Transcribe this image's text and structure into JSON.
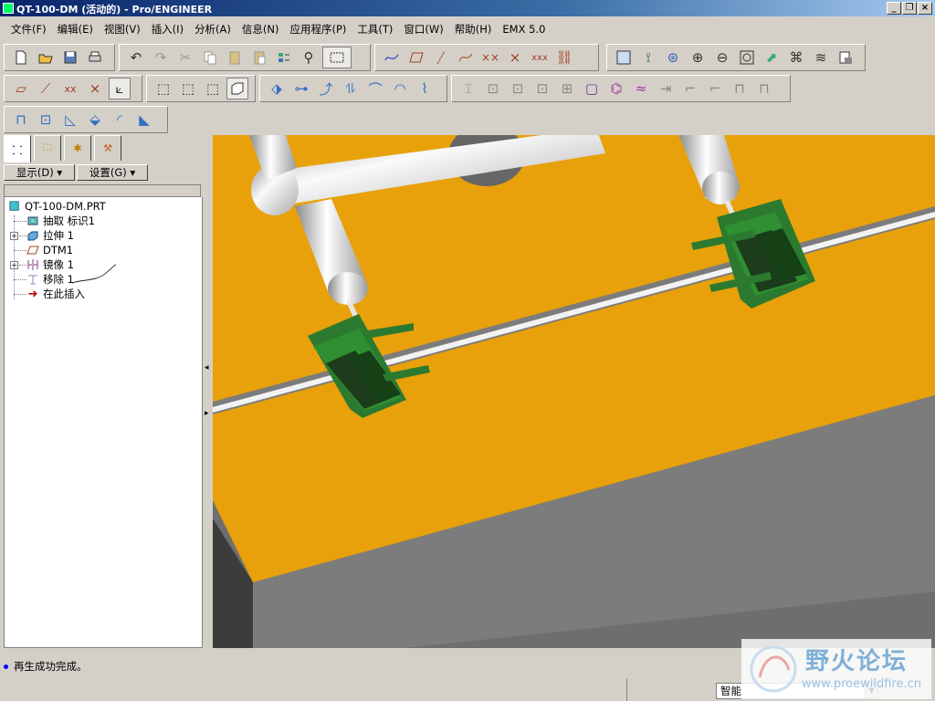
{
  "window": {
    "title": "QT-100-DM (活动的) - Pro/ENGINEER"
  },
  "menu": {
    "items": [
      "文件(F)",
      "编辑(E)",
      "视图(V)",
      "插入(I)",
      "分析(A)",
      "信息(N)",
      "应用程序(P)",
      "工具(T)",
      "窗口(W)",
      "帮助(H)",
      "EMX 5.0"
    ]
  },
  "toolbar": {
    "row1": [
      "new-icon",
      "open-icon",
      "save-icon",
      "print-icon",
      "undo-icon",
      "redo-icon",
      "cut-icon",
      "copy-icon",
      "paste-icon",
      "paste-special-icon",
      "regenerate-icon",
      "find-icon",
      "select-box-icon",
      "datum-display-icon",
      "datum-plane-icon",
      "datum-axis-icon",
      "datum-curve-icon",
      "datum-point-icon",
      "csys-icon",
      "annotation-icon",
      "repaint-icon",
      "orient-icon",
      "spin-center-icon",
      "zoom-in-icon",
      "zoom-out-icon",
      "refit-icon",
      "reorient-icon",
      "saved-views-icon",
      "layers-icon",
      "view-manager-icon"
    ],
    "row2": [
      "sketch-plane-icon",
      "axis-sketch-icon",
      "point-sketch-icon",
      "coordinate-sketch-icon",
      "analysis-icon",
      "wireframe-icon",
      "hidden-line-icon",
      "no-hidden-icon",
      "shaded-icon",
      "extrude-icon",
      "revolve-icon",
      "variable-sweep-icon",
      "blend-icon",
      "style-icon",
      "boundary-icon",
      "warp-icon",
      "hole-icon",
      "shell-icon",
      "rib-icon",
      "draft-icon",
      "round-icon",
      "chamfer-icon",
      "pattern-icon",
      "mirror-icon",
      "merge-icon",
      "trim-icon",
      "offset-icon",
      "thicken-icon",
      "solidify-icon",
      "intersect-icon",
      "project-icon"
    ],
    "row3": [
      "mirror-tool-icon",
      "merge-tool-icon",
      "trim-tool-icon",
      "extend-tool-icon",
      "offset-tool-icon",
      "intersect-tool-icon"
    ]
  },
  "panel": {
    "tabs": [
      "model-tree-icon",
      "folder-browser-icon",
      "favorites-icon",
      "connections-icon"
    ],
    "show_label": "显示(D)",
    "settings_label": "设置(G)",
    "tree": [
      {
        "label": "QT-100-DM.PRT",
        "icon": "part-icon"
      },
      {
        "label": "抽取 标识1",
        "icon": "extract-icon"
      },
      {
        "label": "拉伸 1",
        "icon": "extrude-feature-icon"
      },
      {
        "label": "DTM1",
        "icon": "datum-plane-feature-icon"
      },
      {
        "label": "镜像 1",
        "icon": "mirror-feature-icon"
      },
      {
        "label": "移除 1",
        "icon": "remove-feature-icon"
      },
      {
        "label": "在此插入",
        "icon": "insert-here-icon"
      }
    ]
  },
  "status": {
    "message": "再生成功完成。",
    "filter_value": "智能"
  },
  "watermark": {
    "text": "野火论坛",
    "url": "www.proewildfire.cn"
  },
  "colors": {
    "mold_plate": "#e8a10a",
    "slider": "#2a7a2e",
    "pin": "#e6e6e6",
    "side": "#7a7a7a",
    "background": "#3aa0dc",
    "title_gradient_start": "#0a246a"
  }
}
